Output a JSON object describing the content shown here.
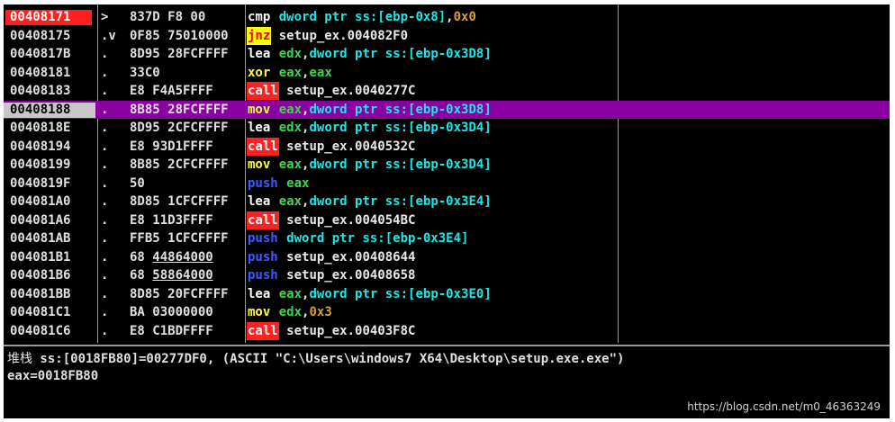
{
  "disassembly": {
    "rows": [
      {
        "address": "00408171",
        "mark": ">",
        "hex": "837D F8 00",
        "mnemonic": "cmp",
        "mtype": "cmp",
        "operands": [
          {
            "t": "dword ptr ss:[ebp-0x8]",
            "c": "mem"
          },
          {
            "t": ",",
            "c": "plain"
          },
          {
            "t": "0x0",
            "c": "imm"
          }
        ]
      },
      {
        "address": "00408175",
        "mark": ".v",
        "hex": "0F85 75010000",
        "mnemonic": "jnz",
        "mtype": "jcc",
        "operands": [
          {
            "t": "setup_ex.004082F0",
            "c": "plain"
          }
        ]
      },
      {
        "address": "0040817B",
        "mark": ".",
        "hex": "8D95 28FCFFFF",
        "mnemonic": "lea",
        "mtype": "lea",
        "operands": [
          {
            "t": "edx",
            "c": "reg"
          },
          {
            "t": ",",
            "c": "plain"
          },
          {
            "t": "dword ptr ss:[ebp-0x3D8]",
            "c": "mem"
          }
        ]
      },
      {
        "address": "00408181",
        "mark": ".",
        "hex": "33C0",
        "mnemonic": "xor",
        "mtype": "xor",
        "operands": [
          {
            "t": "eax",
            "c": "reg"
          },
          {
            "t": ",",
            "c": "plain"
          },
          {
            "t": "eax",
            "c": "reg"
          }
        ]
      },
      {
        "address": "00408183",
        "mark": ".",
        "hex": "E8 F4A5FFFF",
        "mnemonic": "call",
        "mtype": "call",
        "operands": [
          {
            "t": "setup_ex.0040277C",
            "c": "plain"
          }
        ]
      },
      {
        "address": "00408188",
        "mark": ".",
        "hex": "8B85 28FCFFFF",
        "mnemonic": "mov",
        "mtype": "mov",
        "operands": [
          {
            "t": "eax",
            "c": "reg"
          },
          {
            "t": ",",
            "c": "plain"
          },
          {
            "t": "dword ptr ss:[ebp-0x3D8]",
            "c": "mem"
          }
        ]
      },
      {
        "address": "0040818E",
        "mark": ".",
        "hex": "8D95 2CFCFFFF",
        "mnemonic": "lea",
        "mtype": "lea",
        "operands": [
          {
            "t": "edx",
            "c": "reg"
          },
          {
            "t": ",",
            "c": "plain"
          },
          {
            "t": "dword ptr ss:[ebp-0x3D4]",
            "c": "mem"
          }
        ]
      },
      {
        "address": "00408194",
        "mark": ".",
        "hex": "E8 93D1FFFF",
        "mnemonic": "call",
        "mtype": "call",
        "operands": [
          {
            "t": "setup_ex.0040532C",
            "c": "plain"
          }
        ]
      },
      {
        "address": "00408199",
        "mark": ".",
        "hex": "8B85 2CFCFFFF",
        "mnemonic": "mov",
        "mtype": "mov",
        "operands": [
          {
            "t": "eax",
            "c": "reg"
          },
          {
            "t": ",",
            "c": "plain"
          },
          {
            "t": "dword ptr ss:[ebp-0x3D4]",
            "c": "mem"
          }
        ]
      },
      {
        "address": "0040819F",
        "mark": ".",
        "hex": "50",
        "mnemonic": "push",
        "mtype": "push",
        "operands": [
          {
            "t": "eax",
            "c": "reg"
          }
        ]
      },
      {
        "address": "004081A0",
        "mark": ".",
        "hex": "8D85 1CFCFFFF",
        "mnemonic": "lea",
        "mtype": "lea",
        "operands": [
          {
            "t": "eax",
            "c": "reg"
          },
          {
            "t": ",",
            "c": "plain"
          },
          {
            "t": "dword ptr ss:[ebp-0x3E4]",
            "c": "mem"
          }
        ]
      },
      {
        "address": "004081A6",
        "mark": ".",
        "hex": "E8 11D3FFFF",
        "mnemonic": "call",
        "mtype": "call",
        "operands": [
          {
            "t": "setup_ex.004054BC",
            "c": "plain"
          }
        ]
      },
      {
        "address": "004081AB",
        "mark": ".",
        "hex": "FFB5 1CFCFFFF",
        "mnemonic": "push",
        "mtype": "push",
        "operands": [
          {
            "t": "dword ptr ss:[ebp-0x3E4]",
            "c": "mem"
          }
        ]
      },
      {
        "address": "004081B1",
        "mark": ".",
        "hex": "68 44864000",
        "hex_underline": true,
        "mnemonic": "push",
        "mtype": "push",
        "operands": [
          {
            "t": "setup_ex.00408644",
            "c": "plain"
          }
        ]
      },
      {
        "address": "004081B6",
        "mark": ".",
        "hex": "68 58864000",
        "hex_underline": true,
        "mnemonic": "push",
        "mtype": "push",
        "operands": [
          {
            "t": "setup_ex.00408658",
            "c": "plain"
          }
        ]
      },
      {
        "address": "004081BB",
        "mark": ".",
        "hex": "8D85 20FCFFFF",
        "mnemonic": "lea",
        "mtype": "lea",
        "operands": [
          {
            "t": "eax",
            "c": "reg"
          },
          {
            "t": ",",
            "c": "plain"
          },
          {
            "t": "dword ptr ss:[ebp-0x3E0]",
            "c": "mem"
          }
        ]
      },
      {
        "address": "004081C1",
        "mark": ".",
        "hex": "BA 03000000",
        "mnemonic": "mov",
        "mtype": "mov",
        "operands": [
          {
            "t": "edx",
            "c": "reg"
          },
          {
            "t": ",",
            "c": "plain"
          },
          {
            "t": "0x3",
            "c": "imm"
          }
        ]
      },
      {
        "address": "004081C6",
        "mark": ".",
        "hex": "E8 C1BDFFFF",
        "mnemonic": "call",
        "mtype": "call",
        "operands": [
          {
            "t": "setup_ex.00403F8C",
            "c": "plain"
          }
        ]
      }
    ],
    "eip_row": 0,
    "selected_row": 5
  },
  "info": {
    "stack_label": "堆栈",
    "stack_line": " ss:[0018FB80]=00277DF0, (ASCII \"C:\\Users\\windows7 X64\\Desktop\\setup.exe.exe\")",
    "eax_line": "eax=0018FB80"
  },
  "watermark": "https://blog.csdn.net/m0_46363249",
  "colors": {
    "background": "#000000",
    "eip_address": "#ff1f1f",
    "selected_row": "#8a00a0",
    "call_mnemonic": "#ff2020",
    "jcc_mnemonic": "#ffff00",
    "memory_operand": "#19e8e8",
    "register_operand": "#3bd94a",
    "push_mnemonic": "#3a5cff"
  }
}
